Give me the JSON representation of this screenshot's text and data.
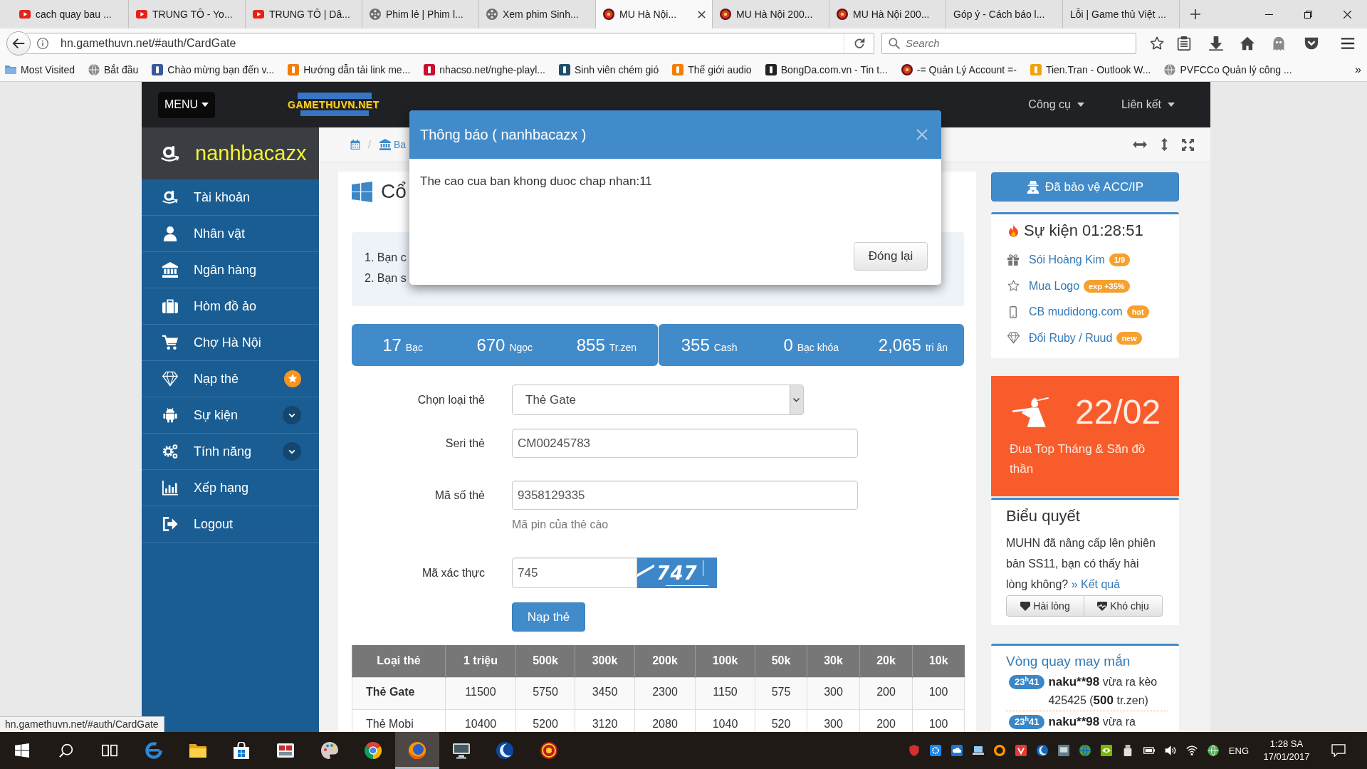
{
  "browser": {
    "tabs": [
      {
        "title": "cach quay bau ...",
        "kind": "video",
        "selected": false
      },
      {
        "title": "TRUNG TÔ - Yo...",
        "kind": "video",
        "selected": false
      },
      {
        "title": "TRUNG TÔ | Dâ...",
        "kind": "video",
        "selected": false
      },
      {
        "title": "Phim lẻ | Phim l...",
        "kind": "reel",
        "selected": false
      },
      {
        "title": "Xem phim Sinh...",
        "kind": "reel",
        "selected": false
      },
      {
        "title": "MU Hà Nội...",
        "kind": "orb",
        "selected": true
      },
      {
        "title": "MU Hà Nội 200...",
        "kind": "orb",
        "selected": false
      },
      {
        "title": "MU Hà Nội 200...",
        "kind": "orb",
        "selected": false
      },
      {
        "title": "Góp ý - Cách báo l...",
        "kind": "plain",
        "selected": false
      },
      {
        "title": "Lỗi | Game thủ Việt ...",
        "kind": "plain",
        "selected": false
      }
    ],
    "address": "hn.gamethuvn.net/#auth/CardGate",
    "search": {
      "placeholder": "Search"
    },
    "bookmarks": [
      {
        "label": "Most Visited",
        "kind": "folder"
      },
      {
        "label": "Bắt đầu",
        "kind": "globe"
      },
      {
        "label": "Chào mừng bạn đến v...",
        "kind": "tile",
        "color": "#3b5998"
      },
      {
        "label": "Hướng dẫn tải link me...",
        "kind": "tile",
        "color": "#f57d00"
      },
      {
        "label": "nhacso.net/nghe-playl...",
        "kind": "tile",
        "color": "#c8102e"
      },
      {
        "label": "Sinh viên chém gió",
        "kind": "tile",
        "color": "#1f4e6b"
      },
      {
        "label": "Thế giới audio",
        "kind": "tile",
        "color": "#f57d00"
      },
      {
        "label": "BongDa.com.vn - Tin t...",
        "kind": "tile",
        "color": "#222222"
      },
      {
        "label": "-= Quản Lý Account =-",
        "kind": "orb"
      },
      {
        "label": "Tien.Tran - Outlook W...",
        "kind": "tile",
        "color": "#f0a30a"
      },
      {
        "label": "PVFCCo Quản lý công ...",
        "kind": "globe"
      }
    ],
    "bookmarks_overflow": "»",
    "status_url": "hn.gamethuvn.net/#auth/CardGate"
  },
  "site": {
    "navbar": {
      "menu": "MENU",
      "logo": "GAMETHUVN.NET",
      "links": [
        "Công cụ",
        "Liên kết"
      ]
    },
    "sidebar": {
      "user": "nanhbacazx",
      "items": [
        {
          "label": "Tài khoản",
          "kind": "link"
        },
        {
          "label": "Nhân vật",
          "kind": "link"
        },
        {
          "label": "Ngân hàng",
          "kind": "link"
        },
        {
          "label": "Hòm đồ ảo",
          "kind": "link"
        },
        {
          "label": "Chợ Hà Nội",
          "kind": "link"
        },
        {
          "label": "Nạp thẻ",
          "kind": "featured"
        },
        {
          "label": "Sự kiện",
          "kind": "group",
          "expanded": false
        },
        {
          "label": "Tính năng",
          "kind": "group",
          "expanded": false
        },
        {
          "label": "Xếp hạng",
          "kind": "link"
        },
        {
          "label": "Logout",
          "kind": "link"
        }
      ]
    },
    "breadcrumb": {
      "separator": "/",
      "items": [
        "Ba"
      ]
    },
    "page_title": "Cổ",
    "notes": [
      "1. Bạn c",
      "2. Bạn s"
    ],
    "stats": [
      [
        {
          "value": "17",
          "unit": "Bạc"
        },
        {
          "value": "670",
          "unit": "Ngọc"
        },
        {
          "value": "855",
          "unit": "Tr.zen"
        }
      ],
      [
        {
          "value": "355",
          "unit": "Cash"
        },
        {
          "value": "0",
          "unit": "Bạc khóa"
        },
        {
          "value": "2,065",
          "unit": "tri ân"
        }
      ]
    ],
    "form": {
      "fields": [
        {
          "kind": "select",
          "label": "Chọn loại thẻ",
          "value": "Thẻ Gate"
        },
        {
          "kind": "text",
          "label": "Seri thẻ",
          "value": "CM00245783"
        },
        {
          "kind": "text",
          "label": "Mã số thẻ",
          "value": "9358129335",
          "help": "Mã pin của thẻ cào"
        },
        {
          "kind": "captcha",
          "label": "Mã xác thực",
          "value": "745",
          "captcha": "747"
        }
      ],
      "submit": "Nạp thẻ"
    },
    "rates_table": {
      "columns": [
        "Loại thẻ",
        "1 triệu",
        "500k",
        "300k",
        "200k",
        "100k",
        "50k",
        "30k",
        "20k",
        "10k"
      ],
      "rows": [
        {
          "selected": true,
          "cells": [
            "Thẻ Gate",
            "11500",
            "5750",
            "3450",
            "2300",
            "1150",
            "575",
            "300",
            "200",
            "100"
          ]
        },
        {
          "selected": false,
          "cells": [
            "Thẻ Mobi",
            "10400",
            "5200",
            "3120",
            "2080",
            "1040",
            "520",
            "300",
            "200",
            "100"
          ]
        }
      ]
    },
    "protect_button": "Đã bảo vệ ACC/IP",
    "events": {
      "title": "Sự kiện 01:28:51",
      "items": [
        {
          "label": "Sói Hoàng Kim",
          "badge": "1/9"
        },
        {
          "label": "Mua Logo",
          "badge": "exp +35%"
        },
        {
          "label": "CB mudidong.com",
          "badge": "hot"
        },
        {
          "label": "Đổi Ruby / Ruud",
          "badge": "new"
        }
      ]
    },
    "promo": {
      "date": "22/02",
      "text": "Đua Top Tháng & Săn đồ thần"
    },
    "poll": {
      "title": "Biểu quyết",
      "question": "MUHN đã nâng cấp lên phiên bản SS11, bạn có thấy hài lòng không?",
      "results_link": "» Kết quả",
      "options": [
        "Hài lòng",
        "Khó chịu"
      ]
    },
    "lucky_wheel": {
      "title": "Vòng quay may mắn",
      "entries": [
        {
          "time": "23$^{h}$41",
          "user": "naku**98",
          "text": "vừa ra kèo 425425 (**500** tr.zen)"
        },
        {
          "time": "23$^{h}$41",
          "user": "naku**98",
          "text": "vừa ra"
        }
      ]
    }
  },
  "modal": {
    "title": "Thông báo ( nanhbacazx )",
    "message": "The cao cua ban khong duoc chap nhan:11",
    "button": "Đóng lại"
  },
  "taskbar": {
    "apps": [
      {
        "active": false
      },
      {
        "active": false
      },
      {
        "active": false
      },
      {
        "active": false
      },
      {
        "active": false
      },
      {
        "active": false
      },
      {
        "active": true
      },
      {
        "active": false
      },
      {
        "active": false
      },
      {
        "active": false
      }
    ],
    "language": "ENG",
    "time": "1:28 SA",
    "date": "17/01/2017"
  }
}
